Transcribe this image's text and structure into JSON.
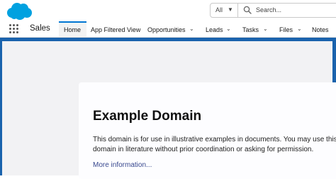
{
  "header": {
    "search_scope": "All",
    "search_placeholder": "Search..."
  },
  "nav": {
    "app_name": "Sales",
    "tabs": [
      {
        "label": "Home",
        "active": true,
        "has_menu": false
      },
      {
        "label": "App Filtered View",
        "active": false,
        "has_menu": false
      },
      {
        "label": "Opportunities",
        "active": false,
        "has_menu": true
      },
      {
        "label": "Leads",
        "active": false,
        "has_menu": true
      },
      {
        "label": "Tasks",
        "active": false,
        "has_menu": true
      },
      {
        "label": "Files",
        "active": false,
        "has_menu": true
      },
      {
        "label": "Notes",
        "active": false,
        "has_menu": false
      }
    ]
  },
  "page": {
    "title": "Example Domain",
    "body": "This domain is for use in illustrative examples in documents. You may use this domain in literature without prior coordination or asking for permission.",
    "link": "More information..."
  },
  "colors": {
    "brand": "#00a1e0",
    "accent": "#0176d3",
    "link": "#38488f",
    "banner": "#1a63ad"
  }
}
